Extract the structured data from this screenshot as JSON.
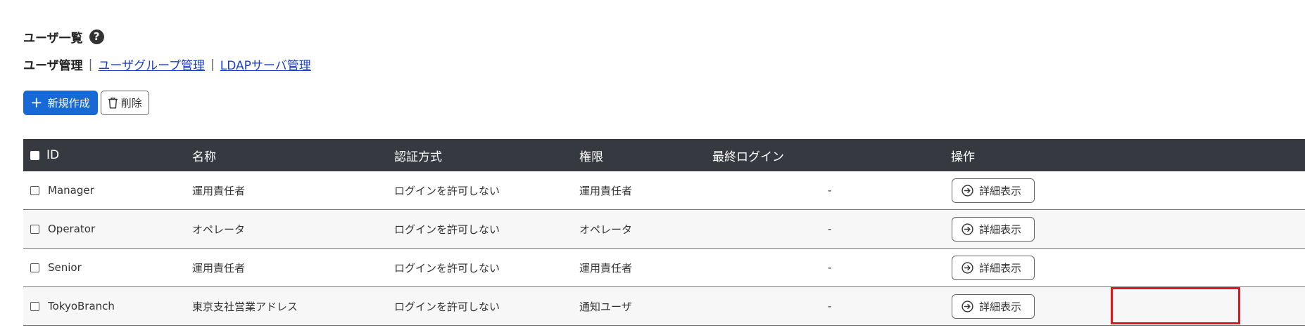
{
  "page": {
    "title": "ユーザ一覧",
    "help_icon": "question-circle-icon",
    "help_glyph": "?"
  },
  "nav": {
    "current": "ユーザ管理",
    "separator": "|",
    "links": [
      "ユーザグループ管理",
      "LDAPサーバ管理"
    ]
  },
  "toolbar": {
    "new_label": "新規作成",
    "new_icon": "plus-icon",
    "delete_label": "削除",
    "delete_icon": "trash-icon"
  },
  "table": {
    "headers": {
      "id": "ID",
      "name": "名称",
      "auth": "認証方式",
      "role": "権限",
      "last_login": "最終ログイン",
      "actions": "操作"
    },
    "rows": [
      {
        "id": "Manager",
        "name": "運用責任者",
        "auth": "ログインを許可しない",
        "role": "運用責任者",
        "last_login": "-",
        "action": "詳細表示"
      },
      {
        "id": "Operator",
        "name": "オペレータ",
        "auth": "ログインを許可しない",
        "role": "オペレータ",
        "last_login": "-",
        "action": "詳細表示"
      },
      {
        "id": "Senior",
        "name": "運用責任者",
        "auth": "ログインを許可しない",
        "role": "運用責任者",
        "last_login": "-",
        "action": "詳細表示"
      },
      {
        "id": "TokyoBranch",
        "name": "東京支社営業アドレス",
        "auth": "ログインを許可しない",
        "role": "通知ユーザ",
        "last_login": "-",
        "action": "詳細表示"
      }
    ],
    "detail_icon": "arrow-right-circle-icon"
  },
  "colors": {
    "header_bg": "#363a40",
    "primary": "#1769d6",
    "link": "#1a3ec9",
    "highlight": "#e0161c"
  }
}
